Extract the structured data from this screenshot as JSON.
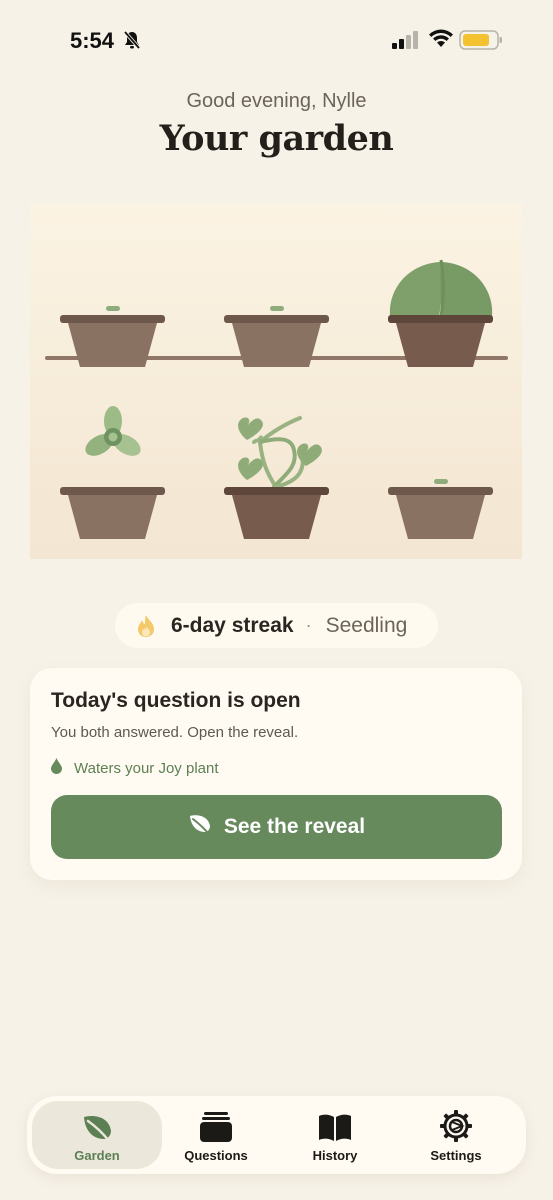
{
  "status_bar": {
    "time": "5:54"
  },
  "header": {
    "greeting": "Good evening, Nylle",
    "title": "Your garden"
  },
  "streak": {
    "label": "6-day streak",
    "separator": "·",
    "stage": "Seedling"
  },
  "question_card": {
    "title": "Today's question is open",
    "subtitle": "You both answered. Open the reveal.",
    "note": "Waters your Joy plant",
    "button_label": "See the reveal"
  },
  "tabs": [
    {
      "label": "Garden",
      "icon": "leaf-icon",
      "active": true
    },
    {
      "label": "Questions",
      "icon": "stack-icon",
      "active": false
    },
    {
      "label": "History",
      "icon": "book-icon",
      "active": false
    },
    {
      "label": "Settings",
      "icon": "gear-icon",
      "active": false
    }
  ],
  "colors": {
    "background": "#f7f2e8",
    "accent_green": "#678a5d",
    "pot_brown": "#8a7060",
    "plant_green": "#7fa06c"
  }
}
